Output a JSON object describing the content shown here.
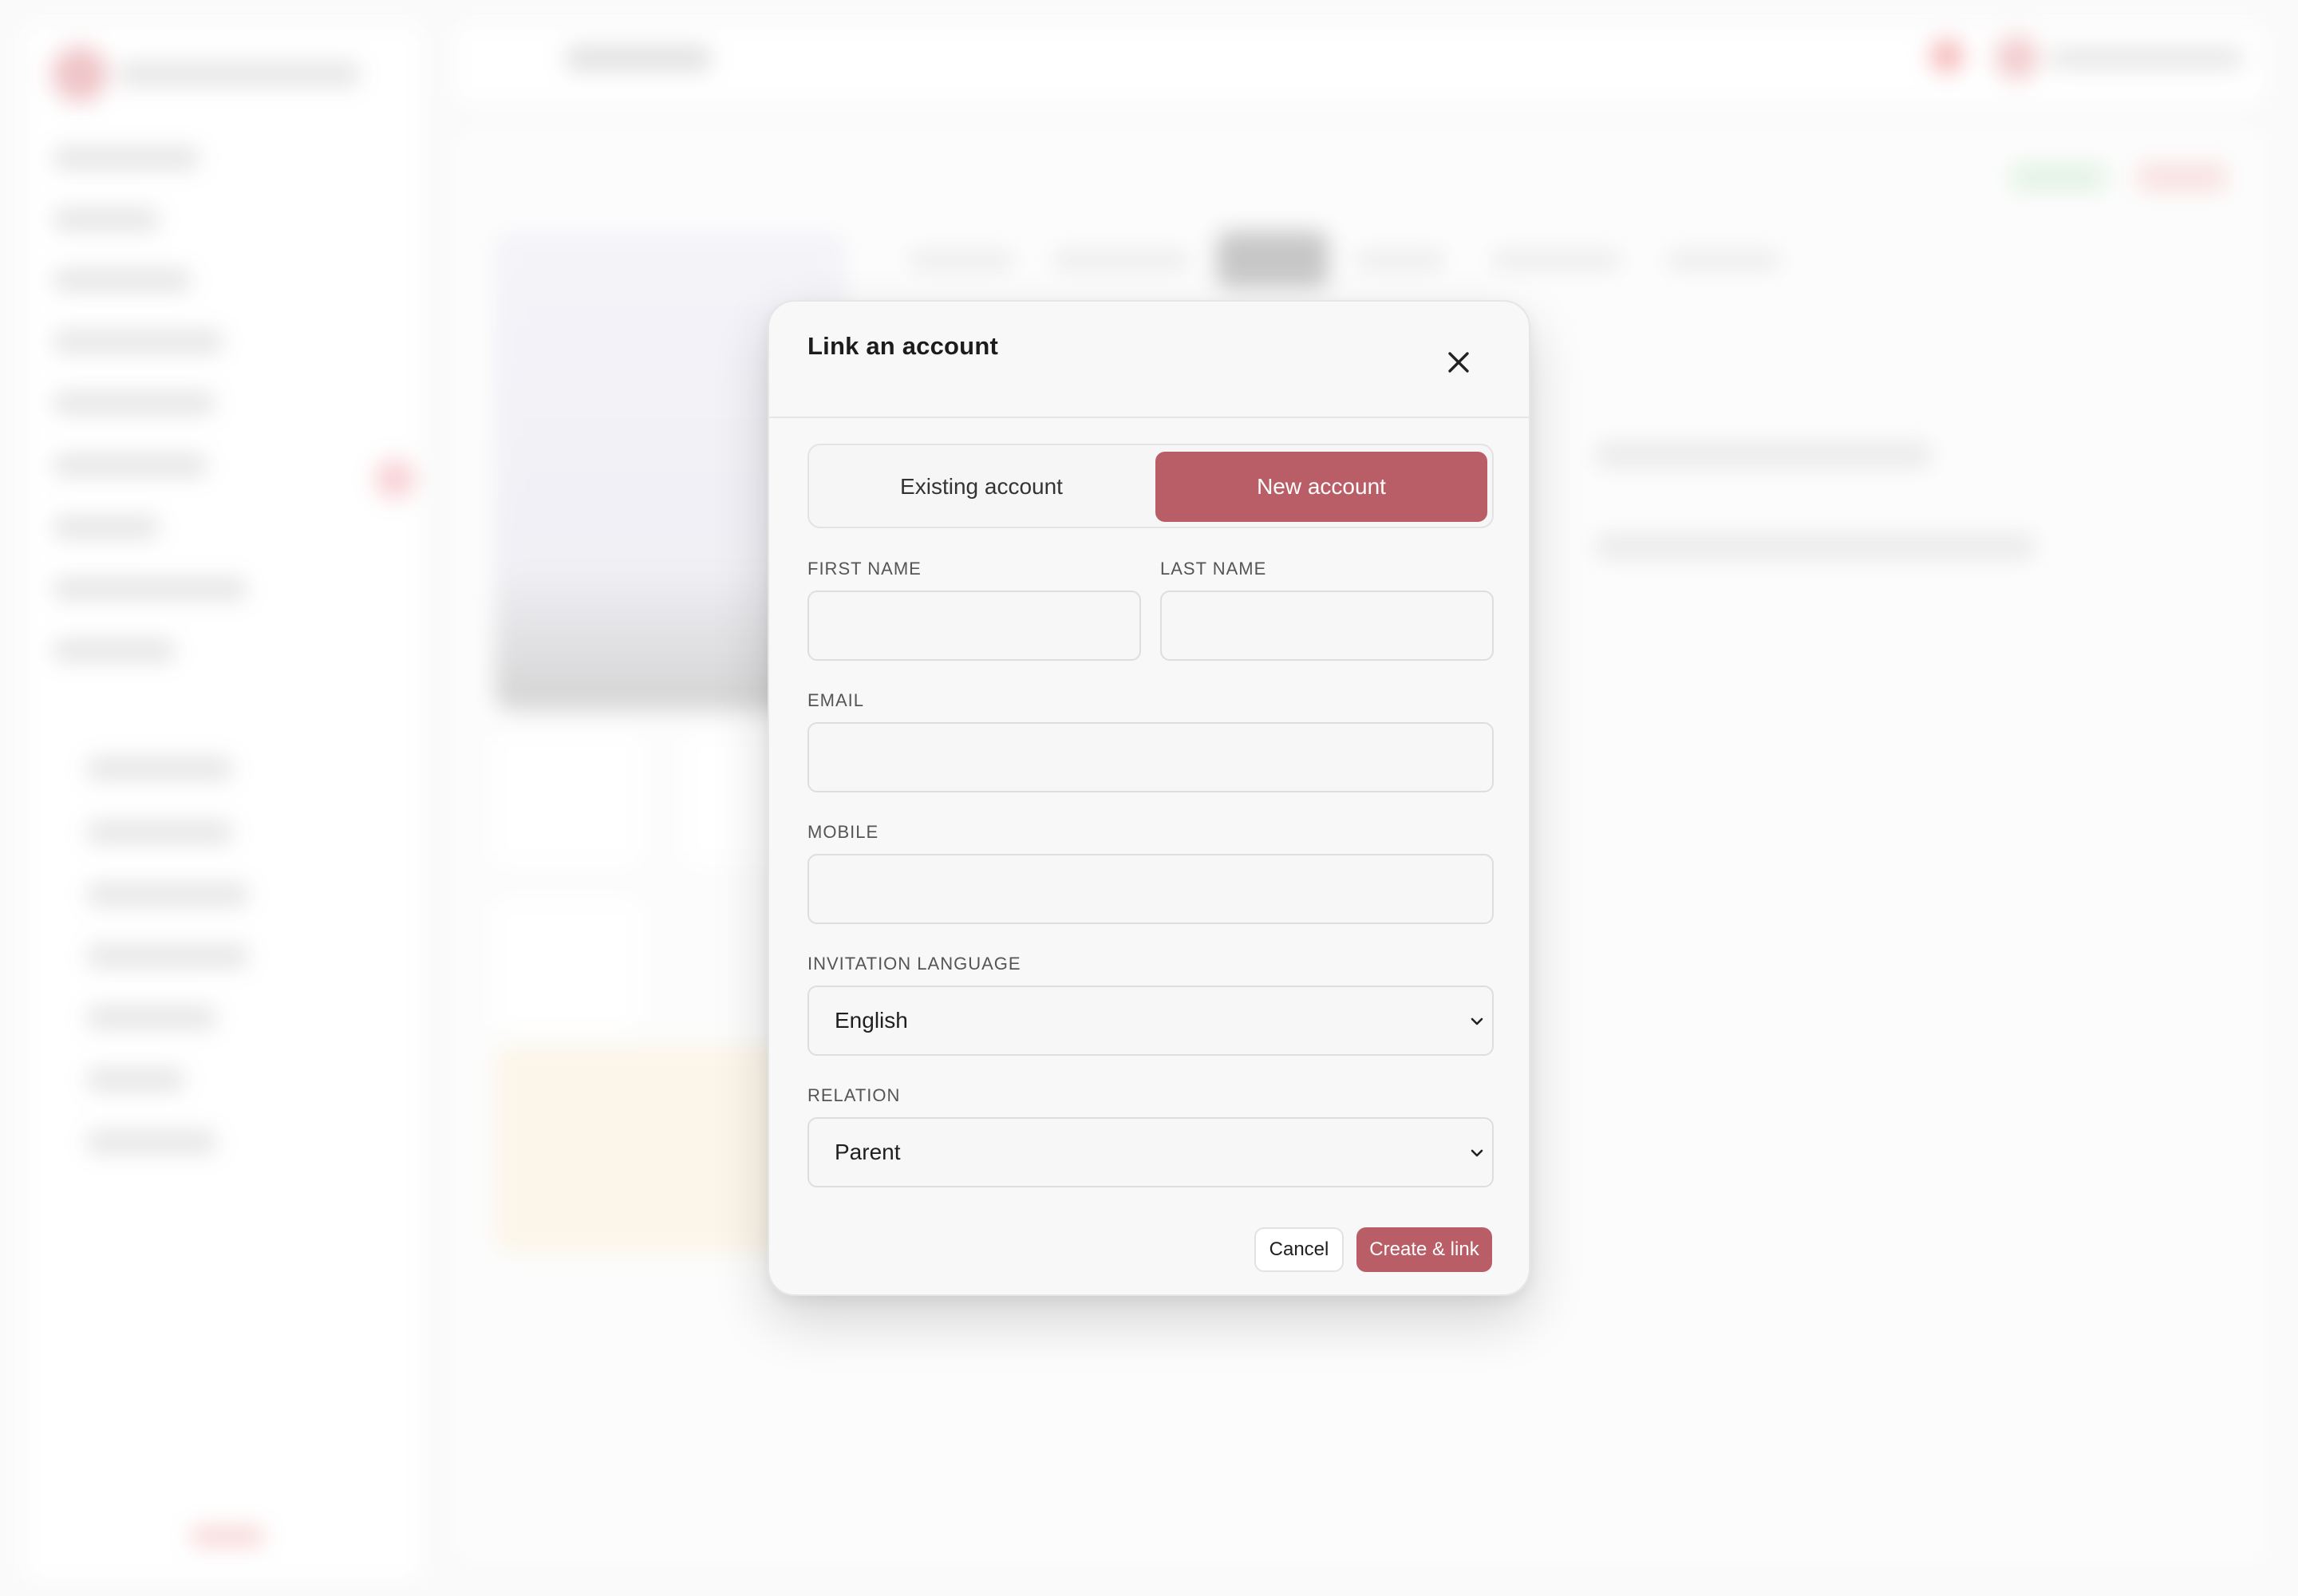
{
  "modal": {
    "title": "Link an account",
    "close_icon": "close-icon",
    "tabs": [
      {
        "label": "Existing account",
        "active": false
      },
      {
        "label": "New account",
        "active": true
      }
    ],
    "fields": {
      "first_name": {
        "label": "FIRST NAME",
        "value": ""
      },
      "last_name": {
        "label": "LAST NAME",
        "value": ""
      },
      "email": {
        "label": "EMAIL",
        "value": ""
      },
      "mobile": {
        "label": "MOBILE",
        "value": ""
      },
      "invitation_language": {
        "label": "INVITATION LANGUAGE",
        "value": "English"
      },
      "relation": {
        "label": "RELATION",
        "value": "Parent"
      }
    },
    "buttons": {
      "cancel": "Cancel",
      "create": "Create & link"
    }
  },
  "colors": {
    "accent": "#b95e66",
    "modal_background": "#f8f8f8"
  }
}
